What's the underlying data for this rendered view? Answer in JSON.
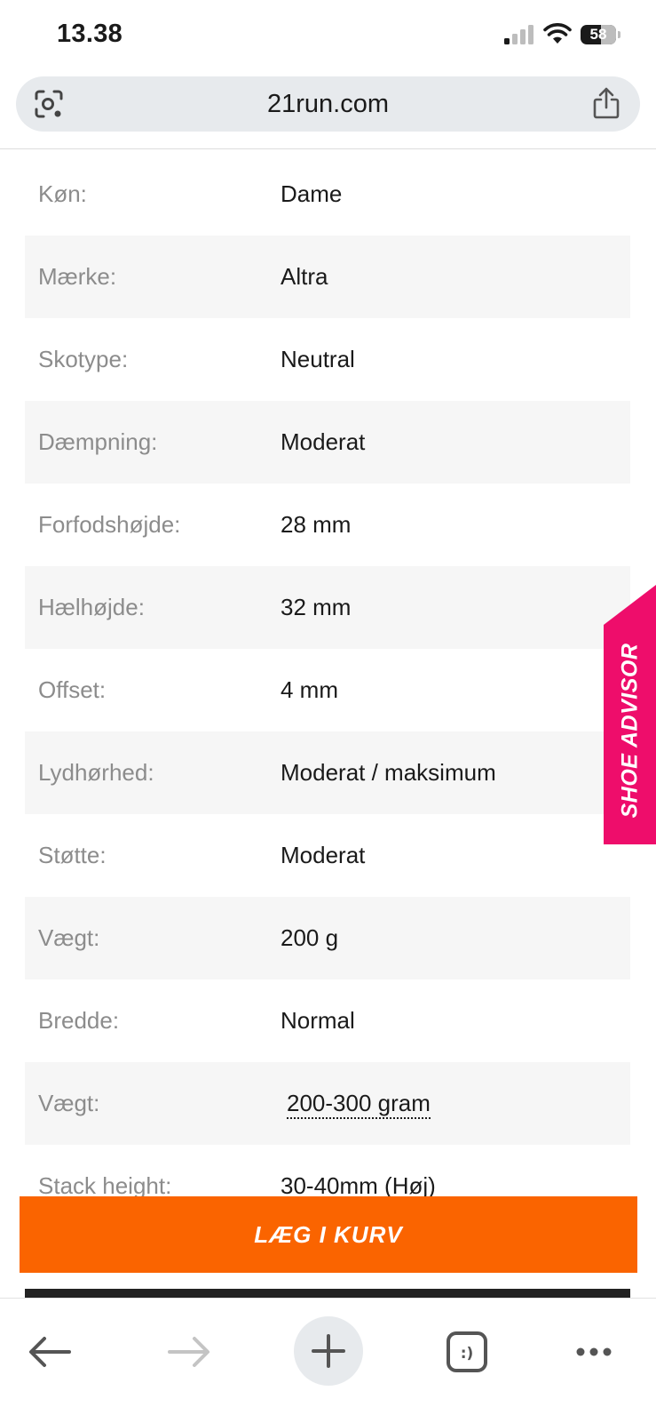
{
  "status_bar": {
    "time": "13.38",
    "battery_percent": "58",
    "icons": [
      "cellular-signal-icon",
      "wifi-icon",
      "battery-icon"
    ]
  },
  "browser": {
    "domain": "21run.com",
    "icons": [
      "lens-icon",
      "share-icon"
    ]
  },
  "specs": {
    "rows": [
      {
        "label": "Køn:",
        "value": "Dame"
      },
      {
        "label": "Mærke:",
        "value": "Altra"
      },
      {
        "label": "Skotype:",
        "value": "Neutral"
      },
      {
        "label": "Dæmpning:",
        "value": "Moderat"
      },
      {
        "label": "Forfodshøjde:",
        "value": "28 mm"
      },
      {
        "label": "Hælhøjde:",
        "value": "32 mm"
      },
      {
        "label": "Offset:",
        "value": "4 mm"
      },
      {
        "label": "Lydhørhed:",
        "value": "Moderat / maksimum"
      },
      {
        "label": "Støtte:",
        "value": "Moderat"
      },
      {
        "label": "Vægt:",
        "value": "200 g"
      },
      {
        "label": "Bredde:",
        "value": "Normal"
      },
      {
        "label": "Vægt:",
        "value": "200-300 gram"
      },
      {
        "label": "Stack height:",
        "value": "30-40mm (Høj)"
      }
    ]
  },
  "shoe_advisor": {
    "label": "SHOE ADVISOR"
  },
  "cart": {
    "label": "LÆG I KURV"
  },
  "toolbar": {
    "icons": [
      "back-arrow-icon",
      "forward-arrow-icon",
      "plus-icon",
      "tabs-icon",
      "more-icon"
    ]
  },
  "colors": {
    "accent_orange": "#fa6400",
    "shoe_advisor_pink": "#ee0d6b",
    "url_bar_bg": "#e7eaed",
    "row_alt_bg": "#f6f6f6",
    "label_gray": "#8c8c8c"
  }
}
